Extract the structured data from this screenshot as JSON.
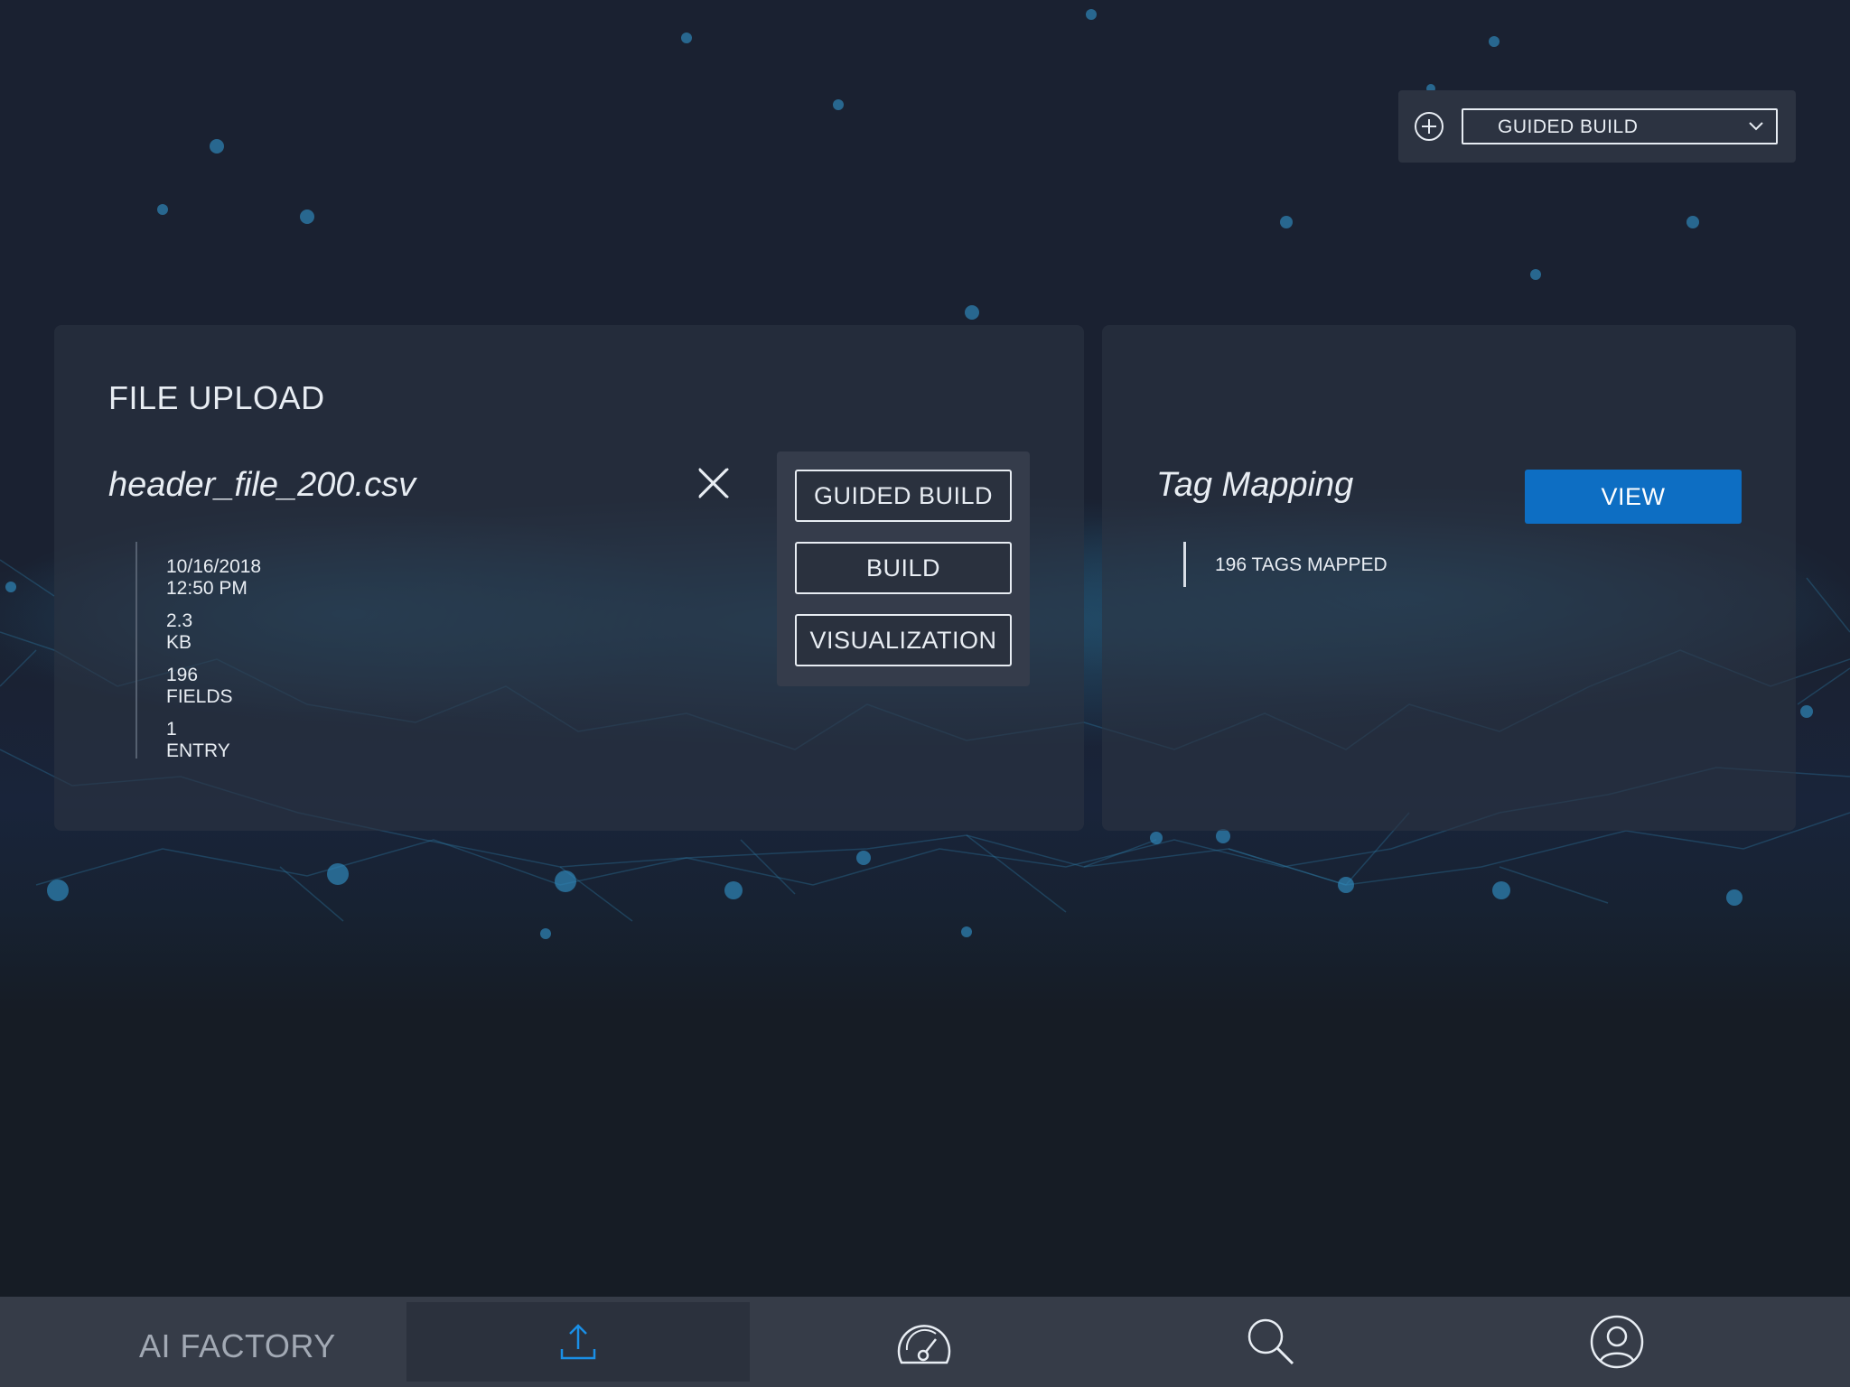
{
  "toolbar": {
    "add_icon": "plus-circle-icon",
    "mode_select": {
      "value": "GUIDED BUILD",
      "icon": "chevron-down-icon"
    }
  },
  "file_upload": {
    "title": "FILE UPLOAD",
    "file_name": "header_file_200.csv",
    "close_icon": "close-icon",
    "meta": {
      "datetime": "10/16/2018  12:50 PM",
      "size": "2.3 KB",
      "fields": "196 FIELDS",
      "entries": "1 ENTRY"
    },
    "actions": {
      "guided_build": "GUIDED BUILD",
      "build": "BUILD",
      "visualization": "VISUALIZATION"
    }
  },
  "tag_mapping": {
    "title": "Tag Mapping",
    "view_label": "VIEW",
    "mapped": "196  TAGS MAPPED"
  },
  "bottom_nav": {
    "brand": "AI FACTORY",
    "items": [
      {
        "icon": "upload-icon",
        "active": true
      },
      {
        "icon": "dashboard-gauge-icon",
        "active": false
      },
      {
        "icon": "search-icon",
        "active": false
      },
      {
        "icon": "user-profile-icon",
        "active": false
      }
    ]
  },
  "colors": {
    "accent": "#0d6ec3",
    "nav_active_icon": "#1a8fe6",
    "background": "#1a2131",
    "card": "#2c3341"
  }
}
